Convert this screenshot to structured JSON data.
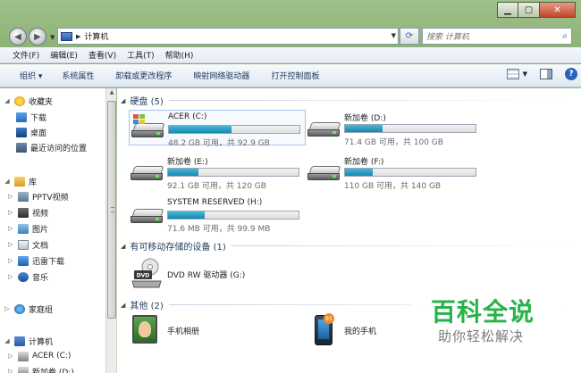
{
  "window": {
    "controls": {
      "minimize": "▁",
      "maximize": "▢",
      "close": "✕"
    }
  },
  "address": {
    "path": "计算机",
    "search_placeholder": "搜索 计算机"
  },
  "menubar": [
    "文件(F)",
    "编辑(E)",
    "查看(V)",
    "工具(T)",
    "帮助(H)"
  ],
  "toolbar": {
    "organize": "组织 ▾",
    "items": [
      "系统属性",
      "卸载或更改程序",
      "映射网络驱动器",
      "打开控制面板"
    ]
  },
  "sidebar": {
    "favorites": {
      "label": "收藏夹",
      "items": [
        "下载",
        "桌面",
        "最近访问的位置"
      ]
    },
    "libraries": {
      "label": "库",
      "items": [
        "PPTV视频",
        "视频",
        "图片",
        "文档",
        "迅雷下载",
        "音乐"
      ]
    },
    "homegroup": "家庭组",
    "computer": {
      "label": "计算机",
      "items": [
        "ACER (C:)",
        "新加卷 (D:)"
      ]
    }
  },
  "content": {
    "hdd_group": "硬盘 (5)",
    "drives": [
      {
        "name": "ACER (C:)",
        "info": "48.2 GB 可用，共 92.9 GB",
        "used": 0.48
      },
      {
        "name": "新加卷 (D:)",
        "info": "71.4 GB 可用，共 100 GB",
        "used": 0.29
      },
      {
        "name": "新加卷 (E:)",
        "info": "92.1 GB 可用，共 120 GB",
        "used": 0.23
      },
      {
        "name": "新加卷 (F:)",
        "info": "110 GB 可用，共 140 GB",
        "used": 0.21
      },
      {
        "name": "SYSTEM RESERVED (H:)",
        "info": "71.6 MB 可用，共 99.9 MB",
        "used": 0.28
      }
    ],
    "removable_group": "有可移动存储的设备 (1)",
    "dvd": "DVD RW 驱动器 (G:)",
    "other_group": "其他 (2)",
    "others": [
      "手机相册",
      "我的手机"
    ]
  },
  "watermark": {
    "title": "百科全说",
    "subtitle": "助你轻松解决"
  },
  "colors": {
    "bar_fill": "#1a86b0",
    "toolbar_text": "#1e395b",
    "watermark_green": "#27b24a"
  }
}
